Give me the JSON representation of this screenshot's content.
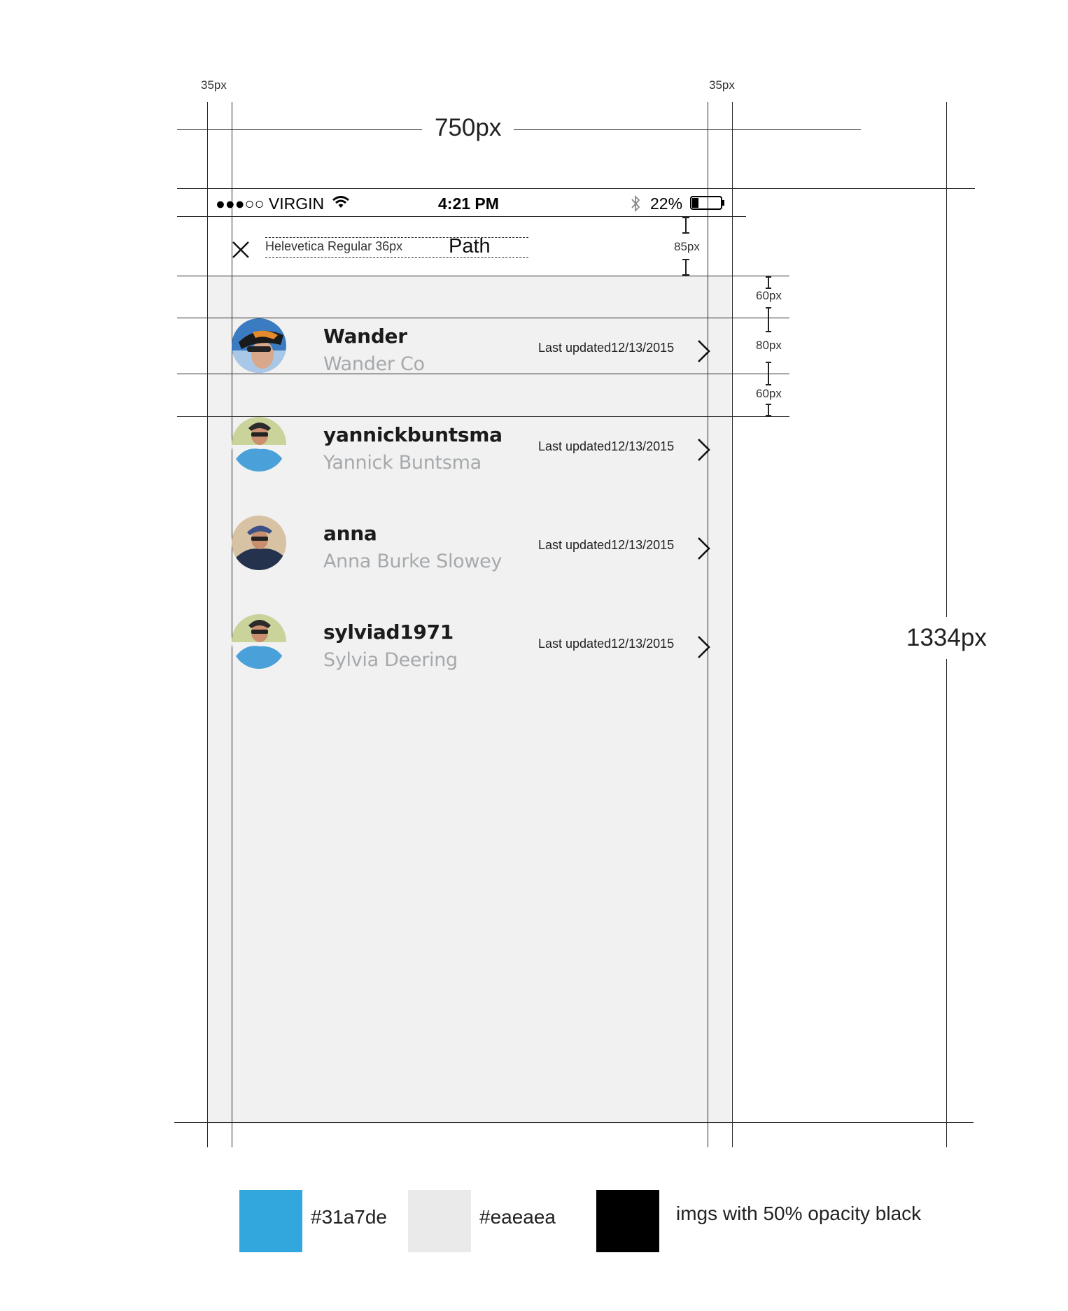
{
  "spec": {
    "width_label": "750px",
    "height_label": "1334px",
    "margin_left_label": "35px",
    "margin_right_label": "35px",
    "header_height_label": "85px",
    "gap_top_label": "60px",
    "row_height_label": "80px",
    "gap_bottom_label": "60px",
    "font_note": "Helevetica Regular 36px"
  },
  "status_bar": {
    "carrier": "●●●○○ VIRGIN",
    "time": "4:21 PM",
    "battery": "22%",
    "icons": [
      "wifi-icon",
      "bluetooth-icon",
      "battery-icon"
    ]
  },
  "header": {
    "title": "Path",
    "close_icon": "close-icon"
  },
  "users": [
    {
      "username": "Wander",
      "fullname": "Wander Co",
      "updated": "Last updated12/13/2015"
    },
    {
      "username": "yannickbuntsma",
      "fullname": "Yannick Buntsma",
      "updated": "Last updated12/13/2015"
    },
    {
      "username": "anna",
      "fullname": "Anna Burke Slowey",
      "updated": "Last updated12/13/2015"
    },
    {
      "username": "sylviad1971",
      "fullname": "Sylvia Deering",
      "updated": "Last updated12/13/2015"
    }
  ],
  "palette": [
    {
      "color": "#31a7de",
      "label": "#31a7de"
    },
    {
      "color": "#eaeaea",
      "label": "#eaeaea"
    },
    {
      "color": "#000000",
      "label": "imgs with 50% opacity black"
    }
  ]
}
